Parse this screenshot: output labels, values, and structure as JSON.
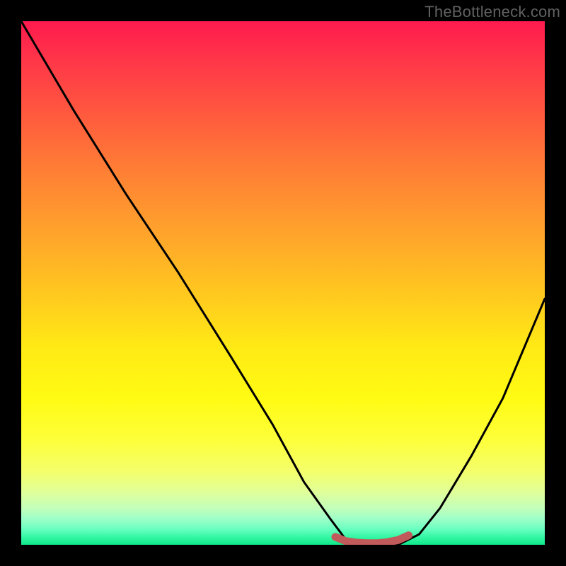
{
  "watermark": "TheBottleneck.com",
  "colors": {
    "frame": "#000000",
    "watermark": "#616161",
    "curve_stroke": "#000000",
    "marker_stroke": "#c15a5a"
  },
  "chart_data": {
    "type": "line",
    "title": "",
    "xlabel": "",
    "ylabel": "",
    "xlim": [
      0,
      100
    ],
    "ylim": [
      0,
      100
    ],
    "grid": false,
    "series": [
      {
        "name": "bottleneck-curve",
        "x": [
          0,
          10,
          20,
          30,
          40,
          48,
          54,
          59,
          62,
          66,
          72,
          76,
          80,
          86,
          92,
          100
        ],
        "values": [
          100,
          83,
          67,
          52,
          36,
          23,
          12,
          5,
          1,
          0,
          0,
          2,
          7,
          17,
          28,
          47
        ]
      }
    ],
    "markers": [
      {
        "name": "optimal-range",
        "x": [
          60,
          62,
          64,
          66,
          68,
          70,
          72,
          74
        ],
        "values": [
          1.5,
          0.7,
          0.4,
          0.3,
          0.3,
          0.5,
          0.9,
          1.8
        ]
      }
    ],
    "gradient_stops": [
      {
        "pos": 0,
        "color": "#ff1a4e"
      },
      {
        "pos": 0.5,
        "color": "#ffc81f"
      },
      {
        "pos": 0.8,
        "color": "#fdff3a"
      },
      {
        "pos": 1.0,
        "color": "#0fe989"
      }
    ]
  }
}
